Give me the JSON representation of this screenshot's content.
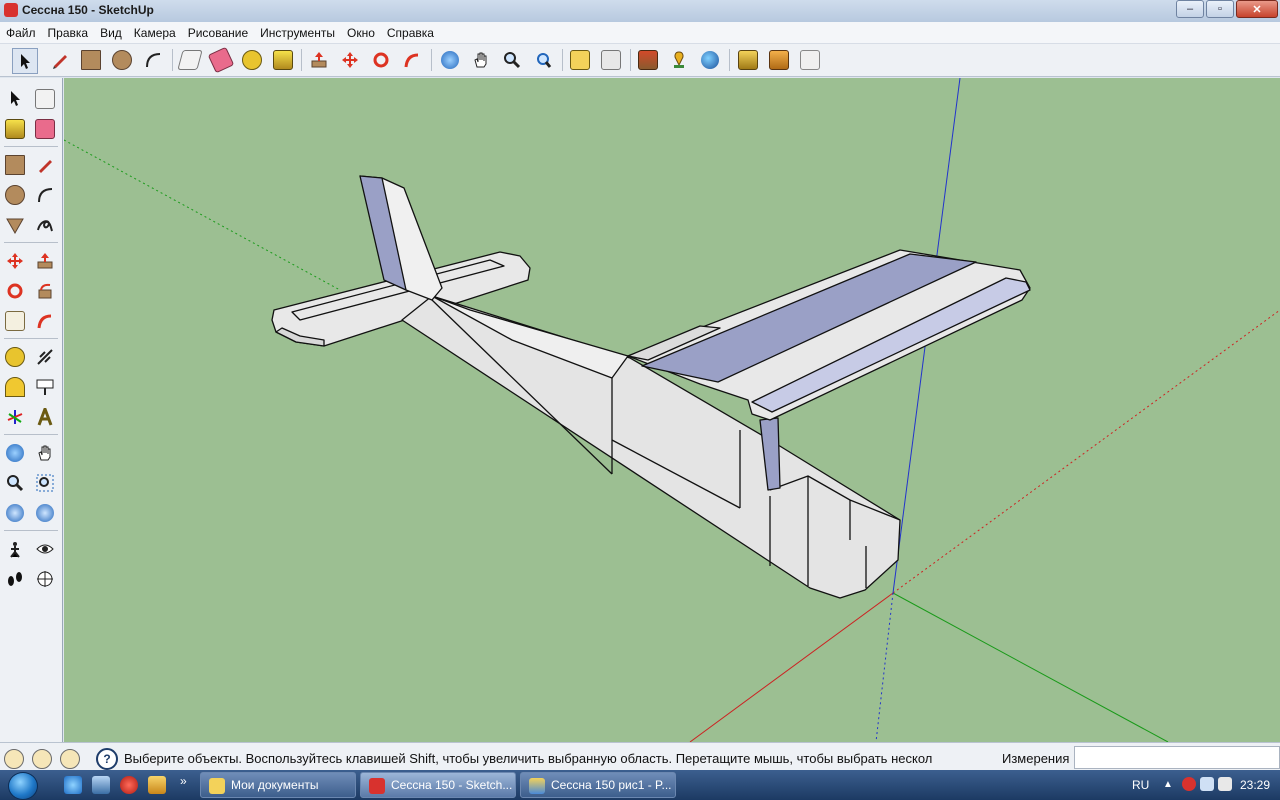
{
  "window": {
    "title": "Сессна 150 - SketchUp",
    "minimize": "–",
    "maximize": "▫",
    "close": "✕"
  },
  "menu": [
    "Файл",
    "Правка",
    "Вид",
    "Камера",
    "Рисование",
    "Инструменты",
    "Окно",
    "Справка"
  ],
  "toolbar_tools": [
    "select-tool",
    "pencil-tool",
    "rectangle-tool",
    "circle-tool",
    "arc-tool",
    "make-component-tool",
    "eraser-tool",
    "tape-measure-tool",
    "paint-bucket-tool",
    "push-pull-tool",
    "move-tool",
    "rotate-tool",
    "follow-me-tool",
    "orbit-tool",
    "pan-tool",
    "zoom-tool",
    "zoom-extents-tool",
    "previous-view-tool",
    "next-view-tool",
    "get-models-tool",
    "add-location-tool",
    "google-earth-tool",
    "share-model-tool",
    "upload-tool",
    "extension-tool"
  ],
  "status": {
    "text": "Выберите объекты. Воспользуйтесь клавишей Shift, чтобы увеличить выбранную область. Перетащите мышь, чтобы выбрать нескол",
    "help": "?",
    "measurements_label": "Измерения",
    "measurements_value": ""
  },
  "taskbar": {
    "tasks": [
      {
        "label": "Мои документы"
      },
      {
        "label": "Сессна 150 - Sketch..."
      },
      {
        "label": "Сессна 150 рис1 - P..."
      }
    ],
    "more": "»",
    "lang": "RU",
    "tray_arrow": "▲",
    "clock": "23:29"
  },
  "colors": {
    "viewport": "#9cbf92",
    "axis_red": "#c22",
    "axis_green": "#1a9a1a",
    "axis_blue": "#2233cc",
    "fuselage": "#e6e6e6",
    "wing_top": "#9aa0c6"
  }
}
